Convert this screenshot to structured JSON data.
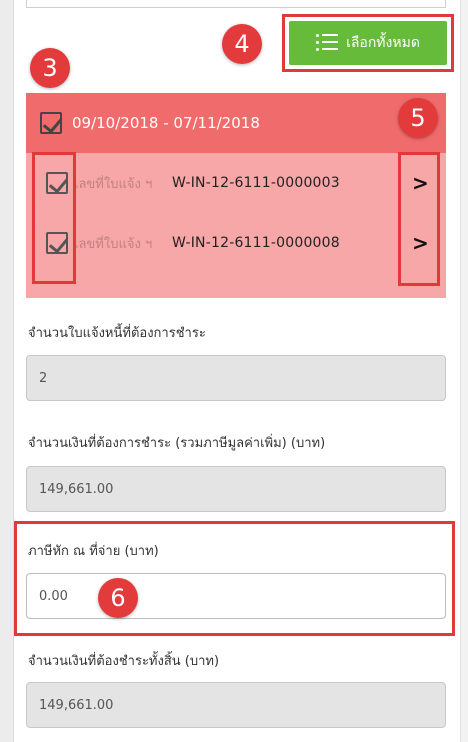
{
  "select_all": {
    "label": "เลือกทั้งหมด"
  },
  "badges": [
    "3",
    "4",
    "5",
    "6"
  ],
  "group": {
    "date_range": "09/10/2018 - 07/11/2018",
    "items": [
      {
        "label": "เลขที่ใบแจ้ง ฯ",
        "number": "W-IN-12-6111-0000003",
        "chevron": ">"
      },
      {
        "label": "เลขที่ใบแจ้ง ฯ",
        "number": "W-IN-12-6111-0000008",
        "chevron": ">"
      }
    ]
  },
  "form": {
    "count_label": "จำนวนใบแจ้งหนี้ที่ต้องการชำระ",
    "count_value": "2",
    "amount_label": "จำนวนเงินที่ต้องการชำระ (รวมภาษีมูลค่าเพิ่ม) (บาท)",
    "amount_value": "149,661.00",
    "tax_label": "ภาษีหัก ณ ที่จ่าย (บาท)",
    "tax_value": "0.00",
    "total_label": "จำนวนเงินที่ต้องชำระทั้งสิ้น (บาท)",
    "total_value": "149,661.00"
  },
  "colors": {
    "accent_green": "#66bb3b",
    "highlight_red": "#e0393a",
    "group_header": "#f06c6c",
    "group_body": "#f7a7a7"
  }
}
